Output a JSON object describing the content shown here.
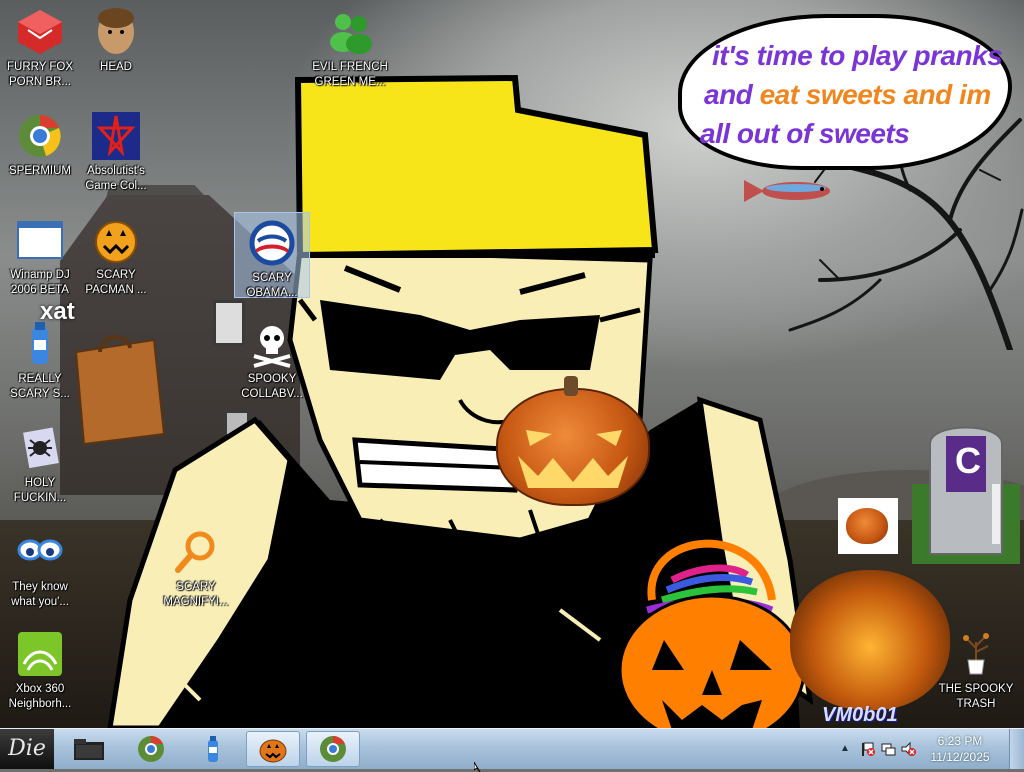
{
  "desktop": {
    "icons": [
      {
        "id": "furry-fox",
        "label": "FURRY FOX\nPORN BR..."
      },
      {
        "id": "head",
        "label": "HEAD"
      },
      {
        "id": "evil-french",
        "label": "EVIL FRENCH\nGREEN ME..."
      },
      {
        "id": "spermium",
        "label": "SPERMIUM"
      },
      {
        "id": "absolutist",
        "label": "Absolutist's\nGame Col..."
      },
      {
        "id": "winamp",
        "label": "Winamp DJ\n2006 BETA"
      },
      {
        "id": "scary-pacman",
        "label": "SCARY\nPACMAN ..."
      },
      {
        "id": "scary-obama",
        "label": "SCARY\nOBAMA..."
      },
      {
        "id": "really-scary",
        "label": "REALLY\nSCARY S..."
      },
      {
        "id": "spooky-collab",
        "label": "SPOOKY\nCOLLABV..."
      },
      {
        "id": "holy",
        "label": "HOLY\nFUCKIN..."
      },
      {
        "id": "they-know",
        "label": "They know\nwhat you'..."
      },
      {
        "id": "scary-magnify",
        "label": "SCARY\nMAGNIFYI..."
      },
      {
        "id": "xbox",
        "label": "Xbox 360\nNeighborh..."
      },
      {
        "id": "spooky-trash",
        "label": "THE SPOOKY\nTRASH"
      }
    ],
    "xat_text": "xat",
    "tombstone_letter": "C",
    "watermark": "VM0b01"
  },
  "speech_bubble": {
    "line1": "it's time to play pranks",
    "line2a": "and ",
    "line2b": "eat sweets and im",
    "line3": "all out of sweets",
    "colors": {
      "purple": "#7b34d6",
      "orange": "#f0871e"
    }
  },
  "taskbar": {
    "start_label": "Die",
    "buttons": [
      {
        "id": "explorer",
        "icon": "folder-icon"
      },
      {
        "id": "browser",
        "icon": "globe-icon"
      },
      {
        "id": "bottle",
        "icon": "bottle-icon"
      },
      {
        "id": "pumpkin",
        "icon": "pumpkin-icon",
        "active": true
      },
      {
        "id": "browser2",
        "icon": "globe-icon",
        "active": true
      }
    ],
    "clock": {
      "time": "6:23 PM",
      "date": "11/12/2025"
    }
  }
}
